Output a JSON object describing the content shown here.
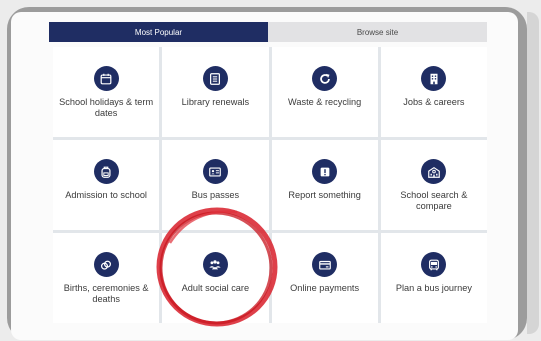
{
  "tabs": {
    "most_popular": "Most Popular",
    "browse_site": "Browse site"
  },
  "tiles": [
    {
      "label": "School holidays & term dates",
      "icon": "calendar-icon"
    },
    {
      "label": "Library renewals",
      "icon": "book-icon"
    },
    {
      "label": "Waste & recycling",
      "icon": "refresh-icon"
    },
    {
      "label": "Jobs & careers",
      "icon": "building-icon"
    },
    {
      "label": "Admission to school",
      "icon": "backpack-icon"
    },
    {
      "label": "Bus passes",
      "icon": "id-card-icon"
    },
    {
      "label": "Report something",
      "icon": "alert-icon"
    },
    {
      "label": "School search & compare",
      "icon": "school-icon"
    },
    {
      "label": "Births, ceremonies & deaths",
      "icon": "rings-icon"
    },
    {
      "label": "Adult social care",
      "icon": "people-icon"
    },
    {
      "label": "Online payments",
      "icon": "payment-card-icon"
    },
    {
      "label": "Plan a bus journey",
      "icon": "bus-icon"
    }
  ],
  "colors": {
    "brand": "#1f2d63",
    "highlight_circle": "#d81e2a"
  }
}
